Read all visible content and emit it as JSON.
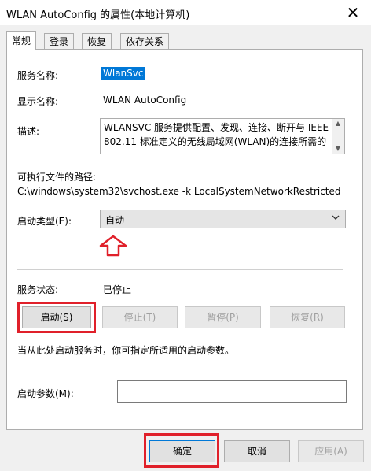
{
  "window": {
    "title": "WLAN AutoConfig 的属性(本地计算机)",
    "close_glyph": "✕"
  },
  "tabs": [
    {
      "label": "常规",
      "active": true
    },
    {
      "label": "登录",
      "active": false
    },
    {
      "label": "恢复",
      "active": false
    },
    {
      "label": "依存关系",
      "active": false
    }
  ],
  "general": {
    "service_name_label": "服务名称:",
    "service_name_value": "WlanSvc",
    "display_name_label": "显示名称:",
    "display_name_value": "WLAN AutoConfig",
    "description_label": "描述:",
    "description_value": "WLANSVC 服务提供配置、发现、连接、断开与 IEEE 802.11 标准定义的无线局域网(WLAN)的连接所需的",
    "exe_path_label": "可执行文件的路径:",
    "exe_path_value": "C:\\windows\\system32\\svchost.exe -k LocalSystemNetworkRestricted",
    "startup_type_label": "启动类型(E):",
    "startup_type_value": "自动",
    "service_status_label": "服务状态:",
    "service_status_value": "已停止",
    "start_button": "启动(S)",
    "stop_button": "停止(T)",
    "pause_button": "暂停(P)",
    "resume_button": "恢复(R)",
    "hint_text": "当从此处启动服务时，你可指定所适用的启动参数。",
    "start_params_label": "启动参数(M):",
    "start_params_value": ""
  },
  "footer": {
    "ok_button": "确定",
    "cancel_button": "取消",
    "apply_button": "应用(A)"
  },
  "colors": {
    "highlight": "#0078d7",
    "annotation_red": "#e0202a"
  }
}
